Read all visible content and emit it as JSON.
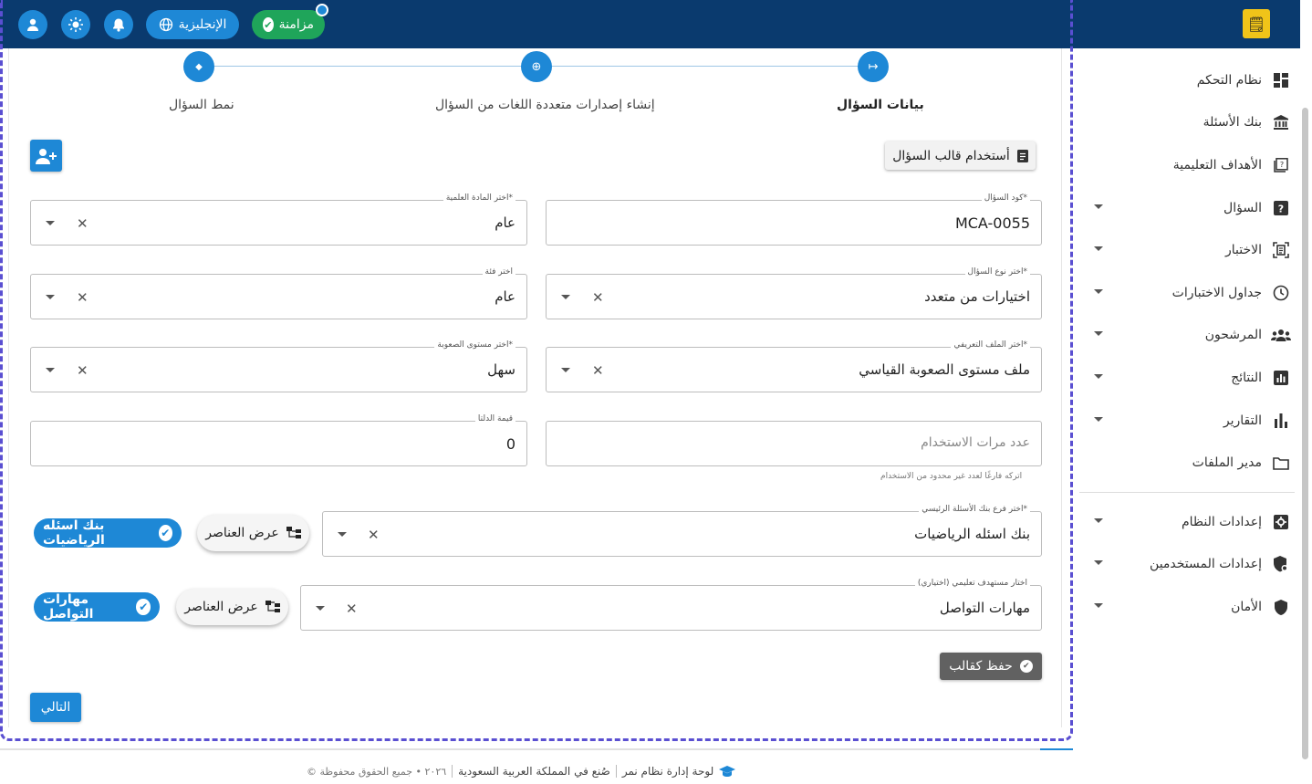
{
  "header": {
    "sync_label": "مزامنة",
    "language_label": "الإنجليزية",
    "logo_text": "🗒"
  },
  "sidebar": {
    "items": [
      {
        "label": "نظام التحكم",
        "icon": "dashboard-icon"
      },
      {
        "label": "بنك الأسئلة",
        "icon": "bank-icon"
      },
      {
        "label": "الأهداف التعليمية",
        "icon": "objectives-icon"
      },
      {
        "label": "السؤال",
        "icon": "question-icon"
      },
      {
        "label": "الاختبار",
        "icon": "exam-icon"
      },
      {
        "label": "جداول الاختبارات",
        "icon": "clock-icon"
      },
      {
        "label": "المرشحون",
        "icon": "people-icon"
      },
      {
        "label": "النتائج",
        "icon": "results-icon"
      },
      {
        "label": "التقارير",
        "icon": "reports-icon"
      },
      {
        "label": "مدير الملفات",
        "icon": "folder-icon"
      },
      {
        "label": "إعدادات النظام",
        "icon": "settings-icon"
      },
      {
        "label": "إعدادات المستخدمين",
        "icon": "user-shield-icon"
      },
      {
        "label": "الأمان",
        "icon": "shield-icon"
      }
    ]
  },
  "stepper": {
    "steps": [
      {
        "label": "بيانات السؤال",
        "icon": "↦"
      },
      {
        "label": "إنشاء إصدارات متعددة اللغات من السؤال",
        "icon": "⊕"
      },
      {
        "label": "نمط السؤال",
        "icon": "◆"
      }
    ]
  },
  "actions": {
    "use_template": "أستخدام قالب السؤال",
    "save_template": "حفظ كقالب",
    "next": "التالي",
    "view_items": "عرض العناصر"
  },
  "form": {
    "question_code": {
      "label": "كود السؤال*",
      "value": "MCA-0055"
    },
    "subject": {
      "label": "اختر المادة العلمية*",
      "value": "عام"
    },
    "question_type": {
      "label": "اختر نوع السؤال*",
      "value": "اختيارات من متعدد"
    },
    "category": {
      "label": "اختر فئة",
      "value": "عام"
    },
    "profile": {
      "label": "اختر الملف التعريفي*",
      "value": "ملف مستوى الصعوبة القياسي"
    },
    "difficulty": {
      "label": "اختر مستوى الصعوبة*",
      "value": "سهل"
    },
    "usage_count": {
      "placeholder": "عدد مرات الاستخدام",
      "hint": "اتركه فارغًا لعدد غير محدود من الاستخدام"
    },
    "delta": {
      "label": "قيمة الدلتا",
      "value": "0"
    },
    "bank_branch": {
      "label": "اختر فرع بنك الأسئلة الرئيسي*",
      "value": "بنك اسئله الرياضيات",
      "chip": "بنك اسئله الرياضيات"
    },
    "learning_target": {
      "label": "اختار مستهدف تعليمي (اختياري)",
      "value": "مهارات التواصل",
      "chip": "مهارات التواصل"
    }
  },
  "footer": {
    "brand": "لوحة إدارة نظام نمر",
    "made_in": "صُنع في المملكة العربية السعودية",
    "copyright": "© ٢٠٢٦ • جميع الحقوق محفوظة"
  },
  "colors": {
    "primary": "#1e88d6",
    "header_bg": "#0a3a6e",
    "sync_green": "#1fa55a",
    "save_grey": "#616161"
  }
}
